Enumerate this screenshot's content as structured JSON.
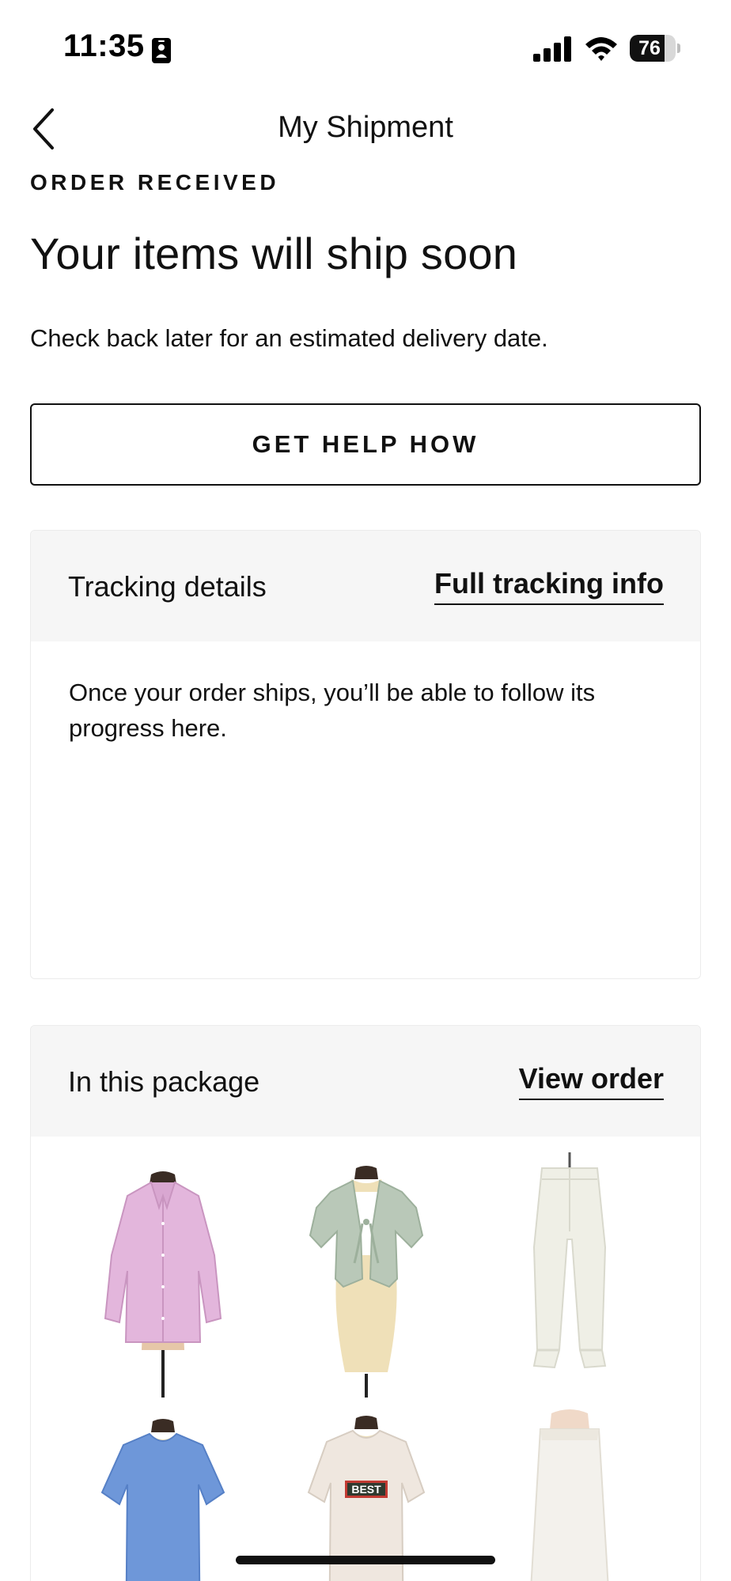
{
  "status_bar": {
    "time": "11:35",
    "battery": "76",
    "battery_level": 0.76,
    "icons": [
      "id-card-icon",
      "cellular-signal-icon",
      "wifi-icon",
      "battery-icon"
    ]
  },
  "nav": {
    "back_icon": "chevron-left-icon",
    "title": "My Shipment"
  },
  "order": {
    "status_label": "ORDER RECEIVED",
    "headline": "Your items will ship soon",
    "subtext": "Check back later for an estimated delivery date."
  },
  "help_button": {
    "label": "GET HELP HOW"
  },
  "tracking": {
    "title": "Tracking details",
    "link": "Full tracking info",
    "message": "Once your order ships, you’ll be able to follow its progress here."
  },
  "package": {
    "title": "In this package",
    "link": "View order",
    "items": [
      {
        "name": "pink-button-down-shirt",
        "color": "#e3b6dc"
      },
      {
        "name": "sage-tie-front-cardigan",
        "color": "#b9c8b8"
      },
      {
        "name": "cream-jogger-pants",
        "color": "#efefe6"
      },
      {
        "name": "blue-tee",
        "color": "#6e97d9"
      },
      {
        "name": "best-graphic-tee",
        "color": "#efe7df"
      },
      {
        "name": "white-skirt",
        "color": "#f3f1ec"
      }
    ]
  },
  "colors": {
    "text": "#111111",
    "panel_bg": "#f6f6f6",
    "border": "#111111"
  }
}
